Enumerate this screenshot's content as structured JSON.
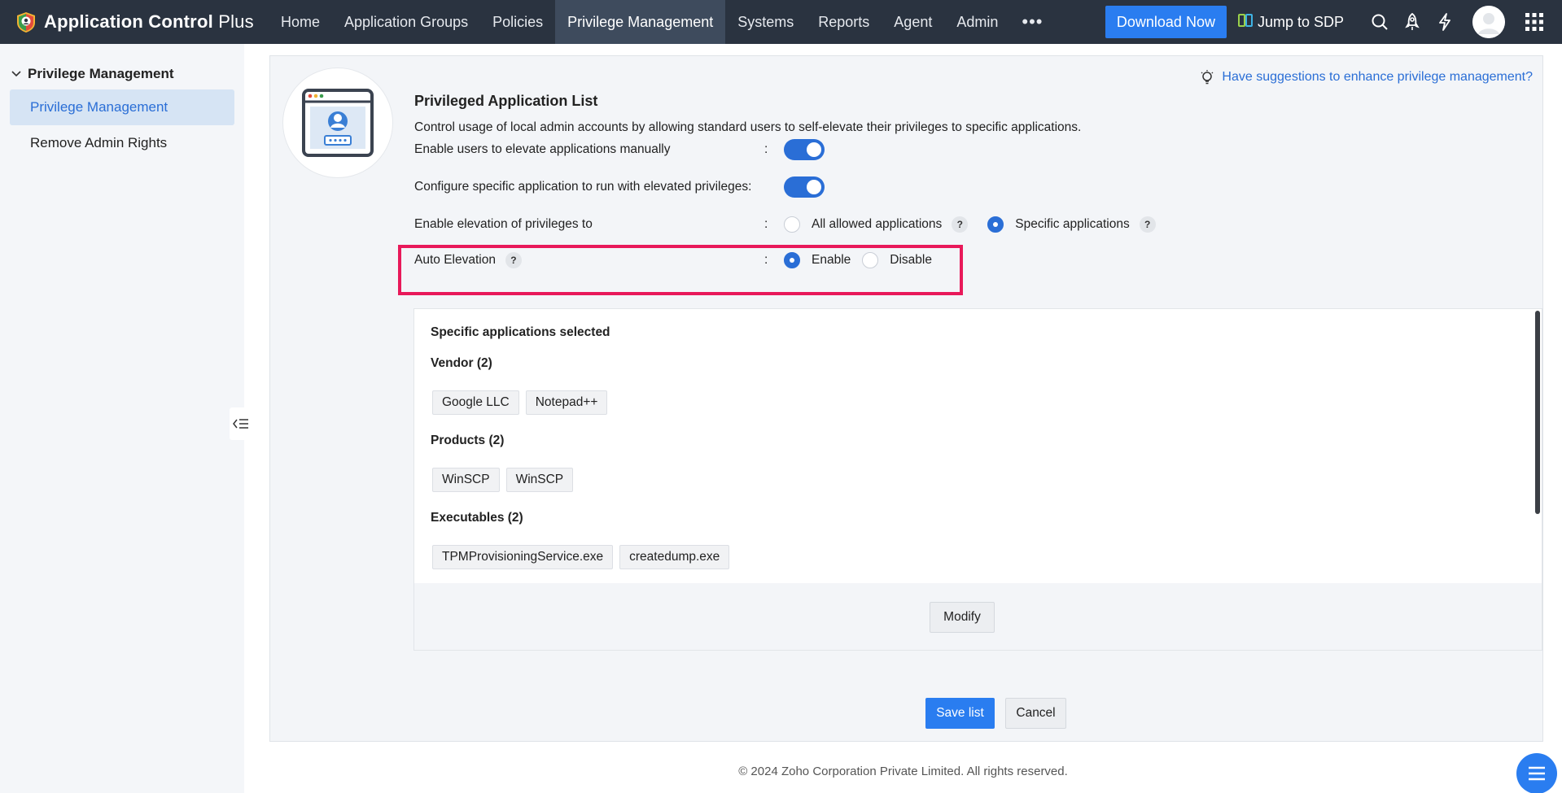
{
  "app": {
    "name_bold": "Application Control",
    "name_light": "Plus"
  },
  "nav": {
    "items": [
      {
        "label": "Home"
      },
      {
        "label": "Application Groups"
      },
      {
        "label": "Policies"
      },
      {
        "label": "Privilege Management",
        "active": true
      },
      {
        "label": "Systems"
      },
      {
        "label": "Reports"
      },
      {
        "label": "Agent"
      },
      {
        "label": "Admin"
      }
    ],
    "more_label": "•••",
    "download_label": "Download Now",
    "jump_label": "Jump to SDP"
  },
  "sidebar": {
    "group_label": "Privilege Management",
    "items": [
      {
        "label": "Privilege Management",
        "active": true
      },
      {
        "label": "Remove Admin Rights"
      }
    ]
  },
  "panel": {
    "suggestion_link": "Have suggestions to enhance privilege management?",
    "title": "Privileged Application List",
    "description": "Control usage of local admin accounts by allowing standard users to self-elevate their privileges to specific applications.",
    "settings": {
      "manual_label": "Enable users to elevate applications manually",
      "manual_colon": ":",
      "manual_enabled": true,
      "configure_label": "Configure specific application to run with elevated privileges:",
      "configure_enabled": true,
      "elevation_label": "Enable elevation of privileges to",
      "elevation_colon": ":",
      "elevation_opt_all": "All allowed applications",
      "elevation_opt_specific": "Specific applications",
      "elevation_selected": "Specific applications",
      "auto_label": "Auto Elevation",
      "auto_colon": ":",
      "auto_opt_enable": "Enable",
      "auto_opt_disable": "Disable",
      "auto_selected": "Enable",
      "help_glyph": "?"
    },
    "apps": {
      "heading": "Specific applications selected",
      "vendor_title": "Vendor (2)",
      "vendors": [
        "Google LLC",
        "Notepad++"
      ],
      "products_title": "Products (2)",
      "products": [
        "WinSCP",
        "WinSCP"
      ],
      "executables_title": "Executables (2)",
      "executables": [
        "TPMProvisioningService.exe",
        "createdump.exe"
      ],
      "modify_label": "Modify"
    },
    "save_label": "Save list",
    "cancel_label": "Cancel"
  },
  "footer": {
    "copyright": "© 2024 Zoho Corporation Private Limited. All rights reserved."
  },
  "colors": {
    "nav_bg": "#2a3340",
    "accent": "#2a7df0",
    "highlight": "#e8195a"
  },
  "icons": [
    "app-logo-icon",
    "search-icon",
    "rocket-icon",
    "lightning-icon",
    "avatar-icon",
    "apps-grid-icon",
    "chevron-down-icon",
    "collapse-sidebar-icon",
    "lightbulb-icon",
    "privileged-app-illustration",
    "menu-icon",
    "sdp-icon"
  ]
}
